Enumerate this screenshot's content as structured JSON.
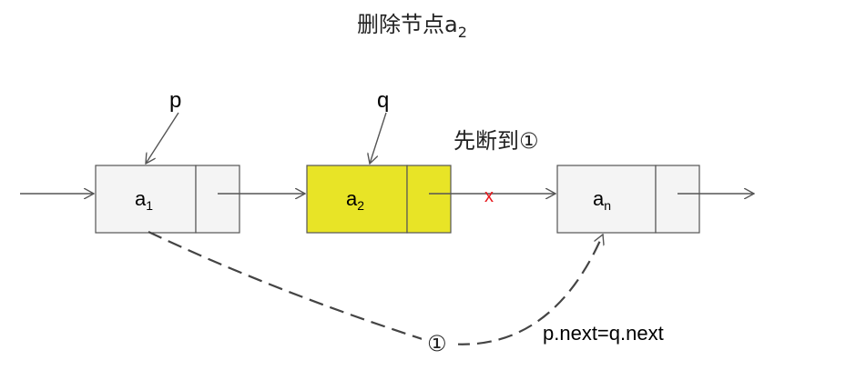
{
  "title": {
    "text": "删除节点a",
    "sub": "2"
  },
  "nodes": [
    {
      "name": "a",
      "sub": "1",
      "fill": "#f4f4f4",
      "pointer": "p"
    },
    {
      "name": "a",
      "sub": "2",
      "fill": "#e8e426",
      "pointer": "q"
    },
    {
      "name": "a",
      "sub": "n",
      "fill": "#f4f4f4",
      "pointer": ""
    }
  ],
  "step_note": "先断到①",
  "break_mark": {
    "text": "x",
    "color": "#e8191e"
  },
  "circled_step": "①",
  "assignment": "p.next=q.next",
  "colors": {
    "stroke": "#555555",
    "highlight": "#e8e426",
    "node": "#f4f4f4"
  }
}
